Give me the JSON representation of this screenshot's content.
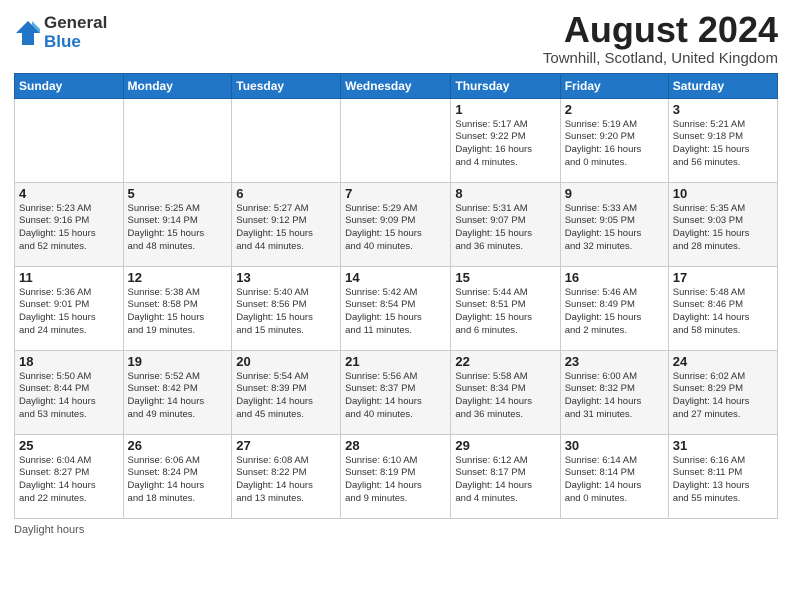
{
  "header": {
    "logo_general": "General",
    "logo_blue": "Blue",
    "main_title": "August 2024",
    "subtitle": "Townhill, Scotland, United Kingdom"
  },
  "calendar": {
    "days_of_week": [
      "Sunday",
      "Monday",
      "Tuesday",
      "Wednesday",
      "Thursday",
      "Friday",
      "Saturday"
    ],
    "weeks": [
      [
        {
          "day": "",
          "info": ""
        },
        {
          "day": "",
          "info": ""
        },
        {
          "day": "",
          "info": ""
        },
        {
          "day": "",
          "info": ""
        },
        {
          "day": "1",
          "info": "Sunrise: 5:17 AM\nSunset: 9:22 PM\nDaylight: 16 hours\nand 4 minutes."
        },
        {
          "day": "2",
          "info": "Sunrise: 5:19 AM\nSunset: 9:20 PM\nDaylight: 16 hours\nand 0 minutes."
        },
        {
          "day": "3",
          "info": "Sunrise: 5:21 AM\nSunset: 9:18 PM\nDaylight: 15 hours\nand 56 minutes."
        }
      ],
      [
        {
          "day": "4",
          "info": "Sunrise: 5:23 AM\nSunset: 9:16 PM\nDaylight: 15 hours\nand 52 minutes."
        },
        {
          "day": "5",
          "info": "Sunrise: 5:25 AM\nSunset: 9:14 PM\nDaylight: 15 hours\nand 48 minutes."
        },
        {
          "day": "6",
          "info": "Sunrise: 5:27 AM\nSunset: 9:12 PM\nDaylight: 15 hours\nand 44 minutes."
        },
        {
          "day": "7",
          "info": "Sunrise: 5:29 AM\nSunset: 9:09 PM\nDaylight: 15 hours\nand 40 minutes."
        },
        {
          "day": "8",
          "info": "Sunrise: 5:31 AM\nSunset: 9:07 PM\nDaylight: 15 hours\nand 36 minutes."
        },
        {
          "day": "9",
          "info": "Sunrise: 5:33 AM\nSunset: 9:05 PM\nDaylight: 15 hours\nand 32 minutes."
        },
        {
          "day": "10",
          "info": "Sunrise: 5:35 AM\nSunset: 9:03 PM\nDaylight: 15 hours\nand 28 minutes."
        }
      ],
      [
        {
          "day": "11",
          "info": "Sunrise: 5:36 AM\nSunset: 9:01 PM\nDaylight: 15 hours\nand 24 minutes."
        },
        {
          "day": "12",
          "info": "Sunrise: 5:38 AM\nSunset: 8:58 PM\nDaylight: 15 hours\nand 19 minutes."
        },
        {
          "day": "13",
          "info": "Sunrise: 5:40 AM\nSunset: 8:56 PM\nDaylight: 15 hours\nand 15 minutes."
        },
        {
          "day": "14",
          "info": "Sunrise: 5:42 AM\nSunset: 8:54 PM\nDaylight: 15 hours\nand 11 minutes."
        },
        {
          "day": "15",
          "info": "Sunrise: 5:44 AM\nSunset: 8:51 PM\nDaylight: 15 hours\nand 6 minutes."
        },
        {
          "day": "16",
          "info": "Sunrise: 5:46 AM\nSunset: 8:49 PM\nDaylight: 15 hours\nand 2 minutes."
        },
        {
          "day": "17",
          "info": "Sunrise: 5:48 AM\nSunset: 8:46 PM\nDaylight: 14 hours\nand 58 minutes."
        }
      ],
      [
        {
          "day": "18",
          "info": "Sunrise: 5:50 AM\nSunset: 8:44 PM\nDaylight: 14 hours\nand 53 minutes."
        },
        {
          "day": "19",
          "info": "Sunrise: 5:52 AM\nSunset: 8:42 PM\nDaylight: 14 hours\nand 49 minutes."
        },
        {
          "day": "20",
          "info": "Sunrise: 5:54 AM\nSunset: 8:39 PM\nDaylight: 14 hours\nand 45 minutes."
        },
        {
          "day": "21",
          "info": "Sunrise: 5:56 AM\nSunset: 8:37 PM\nDaylight: 14 hours\nand 40 minutes."
        },
        {
          "day": "22",
          "info": "Sunrise: 5:58 AM\nSunset: 8:34 PM\nDaylight: 14 hours\nand 36 minutes."
        },
        {
          "day": "23",
          "info": "Sunrise: 6:00 AM\nSunset: 8:32 PM\nDaylight: 14 hours\nand 31 minutes."
        },
        {
          "day": "24",
          "info": "Sunrise: 6:02 AM\nSunset: 8:29 PM\nDaylight: 14 hours\nand 27 minutes."
        }
      ],
      [
        {
          "day": "25",
          "info": "Sunrise: 6:04 AM\nSunset: 8:27 PM\nDaylight: 14 hours\nand 22 minutes."
        },
        {
          "day": "26",
          "info": "Sunrise: 6:06 AM\nSunset: 8:24 PM\nDaylight: 14 hours\nand 18 minutes."
        },
        {
          "day": "27",
          "info": "Sunrise: 6:08 AM\nSunset: 8:22 PM\nDaylight: 14 hours\nand 13 minutes."
        },
        {
          "day": "28",
          "info": "Sunrise: 6:10 AM\nSunset: 8:19 PM\nDaylight: 14 hours\nand 9 minutes."
        },
        {
          "day": "29",
          "info": "Sunrise: 6:12 AM\nSunset: 8:17 PM\nDaylight: 14 hours\nand 4 minutes."
        },
        {
          "day": "30",
          "info": "Sunrise: 6:14 AM\nSunset: 8:14 PM\nDaylight: 14 hours\nand 0 minutes."
        },
        {
          "day": "31",
          "info": "Sunrise: 6:16 AM\nSunset: 8:11 PM\nDaylight: 13 hours\nand 55 minutes."
        }
      ]
    ]
  },
  "footer": {
    "note": "Daylight hours"
  }
}
